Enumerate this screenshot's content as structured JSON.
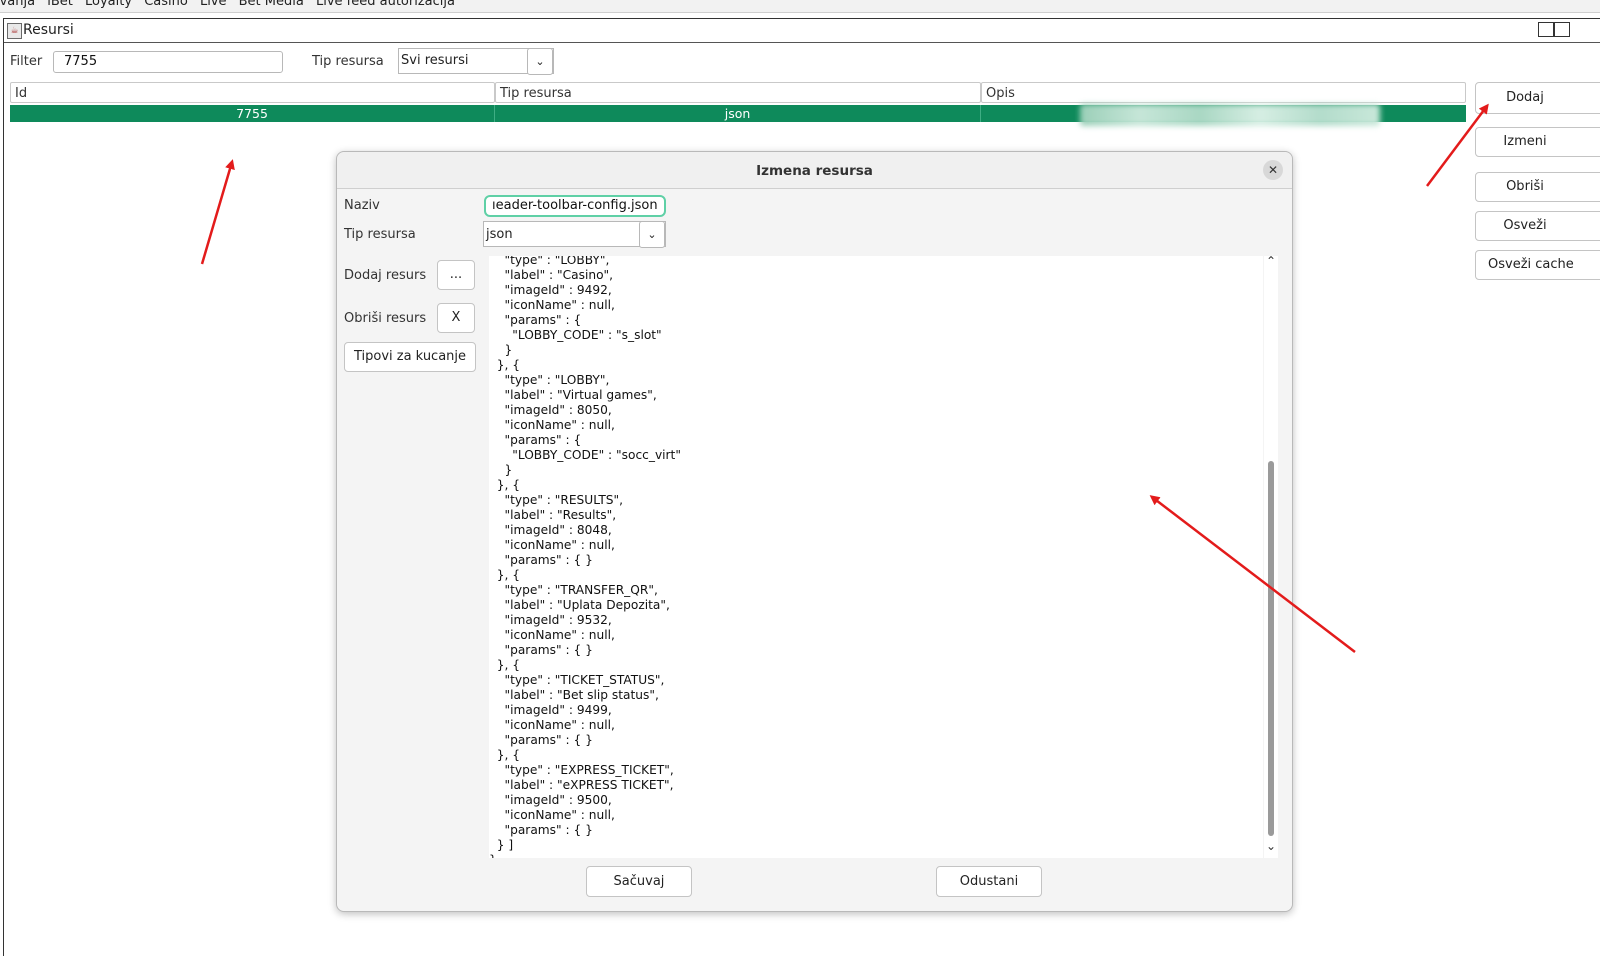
{
  "menubar": {
    "items": [
      "ivanja",
      "iBet",
      "Loyalty",
      "Casino",
      "Live",
      "Bet Media",
      "Live feed autorizacija"
    ]
  },
  "window": {
    "title": "Resursi"
  },
  "filter": {
    "label": "Filter",
    "value": "7755",
    "type_label": "Tip resursa",
    "type_value": "Svi resursi"
  },
  "table": {
    "columns": [
      "Id",
      "Tip resursa",
      "Opis"
    ],
    "rows": [
      {
        "id": "7755",
        "type": "json",
        "opis": ""
      }
    ],
    "selected_color": "#0e8a5b"
  },
  "side_buttons": {
    "add": "Dodaj",
    "edit": "Izmeni",
    "delete": "Obriši",
    "refresh": "Osveži",
    "refresh_cache": "Osveži cache"
  },
  "dialog": {
    "title": "Izmena resursa",
    "naziv_label": "Naziv",
    "naziv_value": "ıeader-toolbar-config.json",
    "tip_label": "Tip resursa",
    "tip_value": "json",
    "add_resource_label": "Dodaj resurs",
    "add_resource_btn": "...",
    "delete_resource_label": "Obriši resurs",
    "delete_resource_btn": "X",
    "typing_types_btn": "Tipovi za kucanje",
    "save_btn": "Sačuvaj",
    "cancel_btn": "Odustani",
    "code": "    \"type\" : \"LOBBY\",\n    \"label\" : \"Casino\",\n    \"imageId\" : 9492,\n    \"iconName\" : null,\n    \"params\" : {\n      \"LOBBY_CODE\" : \"s_slot\"\n    }\n  }, {\n    \"type\" : \"LOBBY\",\n    \"label\" : \"Virtual games\",\n    \"imageId\" : 8050,\n    \"iconName\" : null,\n    \"params\" : {\n      \"LOBBY_CODE\" : \"socc_virt\"\n    }\n  }, {\n    \"type\" : \"RESULTS\",\n    \"label\" : \"Results\",\n    \"imageId\" : 8048,\n    \"iconName\" : null,\n    \"params\" : { }\n  }, {\n    \"type\" : \"TRANSFER_QR\",\n    \"label\" : \"Uplata Depozita\",\n    \"imageId\" : 9532,\n    \"iconName\" : null,\n    \"params\" : { }\n  }, {\n    \"type\" : \"TICKET_STATUS\",\n    \"label\" : \"Bet slip status\",\n    \"imageId\" : 9499,\n    \"iconName\" : null,\n    \"params\" : { }\n  }, {\n    \"type\" : \"EXPRESS_TICKET\",\n    \"label\" : \"eXPRESS TICKET\",\n    \"imageId\" : 9500,\n    \"iconName\" : null,\n    \"params\" : { }\n  } ]\n}"
  },
  "annotation_color": "#e31b1b"
}
